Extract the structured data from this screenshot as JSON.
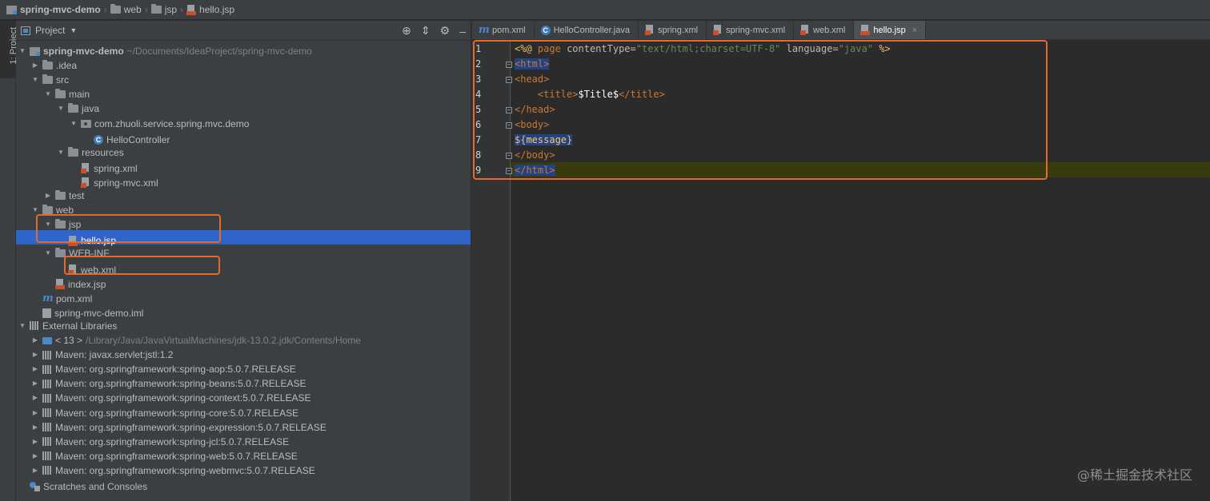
{
  "breadcrumb": [
    "spring-mvc-demo",
    "web",
    "jsp",
    "hello.jsp"
  ],
  "toolstrip": {
    "project_tab": "1: Project"
  },
  "project_panel": {
    "title": "Project",
    "header_icons": [
      "locate-icon",
      "collapse-icon",
      "gear-icon",
      "minimize-icon"
    ]
  },
  "tree": [
    {
      "label": "spring-mvc-demo",
      "hint": "~/Documents/IdeaProject/spring-mvc-demo",
      "icon": "module-icon",
      "arrow": "down",
      "depth": 0,
      "bold": true
    },
    {
      "label": ".idea",
      "icon": "folder-icon",
      "arrow": "right",
      "depth": 1
    },
    {
      "label": "src",
      "icon": "folder-icon",
      "arrow": "down",
      "depth": 1
    },
    {
      "label": "main",
      "icon": "folder-icon",
      "arrow": "down",
      "depth": 2
    },
    {
      "label": "java",
      "icon": "folder-icon",
      "arrow": "down",
      "depth": 3
    },
    {
      "label": "com.zhuoli.service.spring.mvc.demo",
      "icon": "package-icon",
      "arrow": "down",
      "depth": 4
    },
    {
      "label": "HelloController",
      "icon": "class-icon",
      "arrow": "",
      "depth": 5
    },
    {
      "label": "resources",
      "icon": "folder-icon",
      "arrow": "down",
      "depth": 3
    },
    {
      "label": "spring.xml",
      "icon": "xml-file-icon",
      "arrow": "",
      "depth": 4
    },
    {
      "label": "spring-mvc.xml",
      "icon": "xml-file-icon",
      "arrow": "",
      "depth": 4
    },
    {
      "label": "test",
      "icon": "folder-icon",
      "arrow": "right",
      "depth": 2
    },
    {
      "label": "web",
      "icon": "web-folder-icon",
      "arrow": "down",
      "depth": 1
    },
    {
      "label": "jsp",
      "icon": "folder-icon",
      "arrow": "down",
      "depth": 2
    },
    {
      "label": "hello.jsp",
      "icon": "jsp-file-icon",
      "arrow": "",
      "depth": 3,
      "selected": true
    },
    {
      "label": "WEB-INF",
      "icon": "folder-icon",
      "arrow": "down",
      "depth": 2
    },
    {
      "label": "web.xml",
      "icon": "xml-file-icon",
      "arrow": "",
      "depth": 3
    },
    {
      "label": "index.jsp",
      "icon": "jsp-file-icon",
      "arrow": "",
      "depth": 2
    },
    {
      "label": "pom.xml",
      "icon": "maven-icon",
      "arrow": "",
      "depth": 1
    },
    {
      "label": "spring-mvc-demo.iml",
      "icon": "iml-file-icon",
      "arrow": "",
      "depth": 1
    },
    {
      "label": "External Libraries",
      "icon": "library-icon",
      "arrow": "down",
      "depth": 0
    },
    {
      "label": "< 13 >",
      "hint": "/Library/Java/JavaVirtualMachines/jdk-13.0.2.jdk/Contents/Home",
      "icon": "jdk-icon",
      "arrow": "right",
      "depth": 1
    },
    {
      "label": "Maven: javax.servlet:jstl:1.2",
      "icon": "library-icon",
      "arrow": "right",
      "depth": 1
    },
    {
      "label": "Maven: org.springframework:spring-aop:5.0.7.RELEASE",
      "icon": "library-icon",
      "arrow": "right",
      "depth": 1
    },
    {
      "label": "Maven: org.springframework:spring-beans:5.0.7.RELEASE",
      "icon": "library-icon",
      "arrow": "right",
      "depth": 1
    },
    {
      "label": "Maven: org.springframework:spring-context:5.0.7.RELEASE",
      "icon": "library-icon",
      "arrow": "right",
      "depth": 1
    },
    {
      "label": "Maven: org.springframework:spring-core:5.0.7.RELEASE",
      "icon": "library-icon",
      "arrow": "right",
      "depth": 1
    },
    {
      "label": "Maven: org.springframework:spring-expression:5.0.7.RELEASE",
      "icon": "library-icon",
      "arrow": "right",
      "depth": 1
    },
    {
      "label": "Maven: org.springframework:spring-jcl:5.0.7.RELEASE",
      "icon": "library-icon",
      "arrow": "right",
      "depth": 1
    },
    {
      "label": "Maven: org.springframework:spring-web:5.0.7.RELEASE",
      "icon": "library-icon",
      "arrow": "right",
      "depth": 1
    },
    {
      "label": "Maven: org.springframework:spring-webmvc:5.0.7.RELEASE",
      "icon": "library-icon",
      "arrow": "right",
      "depth": 1
    },
    {
      "label": "Scratches and Consoles",
      "icon": "scratches-icon",
      "arrow": "",
      "depth": 0
    }
  ],
  "tabs": [
    {
      "label": "pom.xml",
      "icon": "maven-icon"
    },
    {
      "label": "HelloController.java",
      "icon": "class-icon"
    },
    {
      "label": "spring.xml",
      "icon": "xml-file-icon"
    },
    {
      "label": "spring-mvc.xml",
      "icon": "xml-file-icon"
    },
    {
      "label": "web.xml",
      "icon": "xml-file-icon"
    },
    {
      "label": "hello.jsp",
      "icon": "jsp-file-icon",
      "active": true,
      "close": "×"
    }
  ],
  "editor": {
    "line_numbers": [
      "1",
      "2",
      "3",
      "4",
      "5",
      "6",
      "7",
      "8",
      "9"
    ],
    "code": {
      "l1": {
        "open": "<%@",
        "dir": "page",
        "a1": "contentType",
        "eq1": "=",
        "v1": "\"text/html;charset=UTF-8\"",
        "a2": "language",
        "eq2": "=",
        "v2": "\"java\"",
        "close": "%>"
      },
      "l2": "<html>",
      "l3": "<head>",
      "l4": {
        "open": "<title>",
        "text": "$Title$",
        "close": "</title>"
      },
      "l5": "</head>",
      "l6": "<body>",
      "l7": {
        "open": "${",
        "text": "message",
        "close": "}"
      },
      "l8": "</body>",
      "l9": "</html>"
    }
  },
  "watermark": "@稀土掘金技术社区",
  "colors": {
    "accent_highlight": "#e46a2c",
    "selection": "#2f65ca",
    "background": "#2b2b2b",
    "panel": "#3c3f41"
  }
}
